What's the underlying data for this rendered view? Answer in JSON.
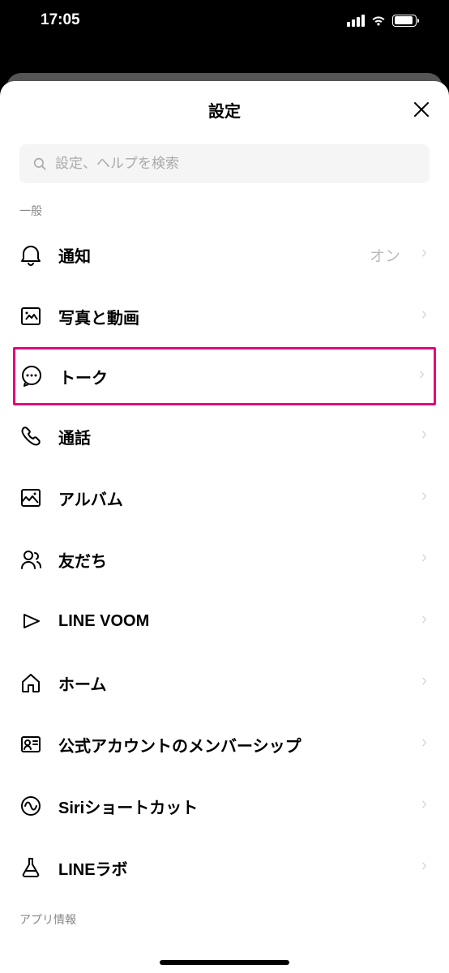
{
  "statusBar": {
    "time": "17:05"
  },
  "sheet": {
    "title": "設定",
    "search": {
      "placeholder": "設定、ヘルプを検索"
    }
  },
  "sections": {
    "general": {
      "label": "一般",
      "items": [
        {
          "icon": "bell",
          "label": "通知",
          "value": "オン",
          "highlighted": false
        },
        {
          "icon": "photo",
          "label": "写真と動画",
          "value": "",
          "highlighted": false
        },
        {
          "icon": "chat",
          "label": "トーク",
          "value": "",
          "highlighted": true
        },
        {
          "icon": "phone",
          "label": "通話",
          "value": "",
          "highlighted": false
        },
        {
          "icon": "album",
          "label": "アルバム",
          "value": "",
          "highlighted": false
        },
        {
          "icon": "friends",
          "label": "友だち",
          "value": "",
          "highlighted": false
        },
        {
          "icon": "voom",
          "label": "LINE VOOM",
          "value": "",
          "highlighted": false
        },
        {
          "icon": "home",
          "label": "ホーム",
          "value": "",
          "highlighted": false
        },
        {
          "icon": "membership",
          "label": "公式アカウントのメンバーシップ",
          "value": "",
          "highlighted": false
        },
        {
          "icon": "siri",
          "label": "Siriショートカット",
          "value": "",
          "highlighted": false
        },
        {
          "icon": "lab",
          "label": "LINEラボ",
          "value": "",
          "highlighted": false
        }
      ]
    },
    "appInfo": {
      "label": "アプリ情報"
    }
  }
}
